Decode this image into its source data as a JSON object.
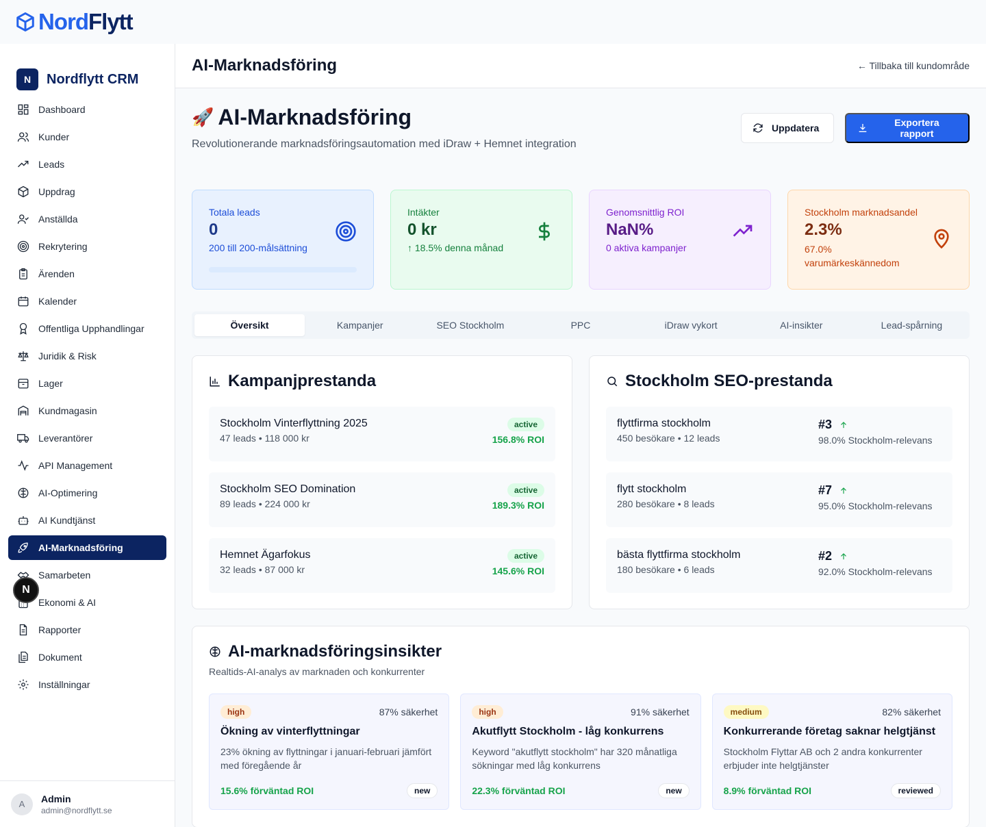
{
  "brand": {
    "part1": "Nord",
    "part2": "Flytt"
  },
  "sidebar": {
    "logo_letter": "N",
    "title": "Nordflytt CRM",
    "items": [
      {
        "label": "Dashboard"
      },
      {
        "label": "Kunder"
      },
      {
        "label": "Leads"
      },
      {
        "label": "Uppdrag"
      },
      {
        "label": "Anställda"
      },
      {
        "label": "Rekrytering"
      },
      {
        "label": "Ärenden"
      },
      {
        "label": "Kalender"
      },
      {
        "label": "Offentliga Upphandlingar"
      },
      {
        "label": "Juridik & Risk"
      },
      {
        "label": "Lager"
      },
      {
        "label": "Kundmagasin"
      },
      {
        "label": "Leverantörer"
      },
      {
        "label": "API Management"
      },
      {
        "label": "AI-Optimering"
      },
      {
        "label": "AI Kundtjänst"
      },
      {
        "label": "AI-Marknadsföring"
      },
      {
        "label": "Samarbeten"
      },
      {
        "label": "Ekonomi & AI"
      },
      {
        "label": "Rapporter"
      },
      {
        "label": "Dokument"
      },
      {
        "label": "Inställningar"
      }
    ],
    "user": {
      "initial": "A",
      "name": "Admin",
      "email": "admin@nordflytt.se"
    },
    "next_badge": "N"
  },
  "header": {
    "title": "AI-Marknadsföring",
    "back_link": "← Tillbaka till kundområde"
  },
  "hero": {
    "emoji": "🚀",
    "title": "AI-Marknadsföring",
    "subtitle": "Revolutionerande marknadsföringsautomation med iDraw + Hemnet integration",
    "refresh_label": "Uppdatera",
    "export_label": "Exportera rapport"
  },
  "stats": {
    "leads": {
      "label": "Totala leads",
      "value": "0",
      "sub": "200 till 200-målsättning",
      "progress": 0
    },
    "revenue": {
      "label": "Intäkter",
      "value": "0 kr",
      "sub": "↑ 18.5% denna månad"
    },
    "roi": {
      "label": "Genomsnittlig ROI",
      "value": "NaN%",
      "sub": "0 aktiva kampanjer"
    },
    "share": {
      "label": "Stockholm marknadsandel",
      "value": "2.3%",
      "sub": "67.0% varumärkeskännedom"
    }
  },
  "tabs": [
    "Översikt",
    "Kampanjer",
    "SEO Stockholm",
    "PPC",
    "iDraw vykort",
    "AI-insikter",
    "Lead-spårning"
  ],
  "campaigns": {
    "title": "Kampanjprestanda",
    "items": [
      {
        "name": "Stockholm Vinterflyttning 2025",
        "meta": "47 leads • 118 000 kr",
        "status": "active",
        "roi": "156.8% ROI"
      },
      {
        "name": "Stockholm SEO Domination",
        "meta": "89 leads • 224 000 kr",
        "status": "active",
        "roi": "189.3% ROI"
      },
      {
        "name": "Hemnet Ägarfokus",
        "meta": "32 leads • 87 000 kr",
        "status": "active",
        "roi": "145.6% ROI"
      }
    ]
  },
  "seo": {
    "title": "Stockholm SEO-prestanda",
    "items": [
      {
        "keyword": "flyttfirma stockholm",
        "meta": "450 besökare • 12 leads",
        "rank": "#3",
        "relevance": "98.0% Stockholm-relevans"
      },
      {
        "keyword": "flytt stockholm",
        "meta": "280 besökare • 8 leads",
        "rank": "#7",
        "relevance": "95.0% Stockholm-relevans"
      },
      {
        "keyword": "bästa flyttfirma stockholm",
        "meta": "180 besökare • 6 leads",
        "rank": "#2",
        "relevance": "92.0% Stockholm-relevans"
      }
    ]
  },
  "insights": {
    "title": "AI-marknadsföringsinsikter",
    "subtitle": "Realtids-AI-analys av marknaden och konkurrenter",
    "items": [
      {
        "priority": "high",
        "confidence": "87% säkerhet",
        "title": "Ökning av vinterflyttningar",
        "desc": "23% ökning av flyttningar i januari-februari jämfört med föregående år",
        "roi": "15.6% förväntad ROI",
        "status": "new"
      },
      {
        "priority": "high",
        "confidence": "91% säkerhet",
        "title": "Akutflytt Stockholm - låg konkurrens",
        "desc": "Keyword \"akutflytt stockholm\" har 320 månatliga sökningar med låg konkurrens",
        "roi": "22.3% förväntad ROI",
        "status": "new"
      },
      {
        "priority": "medium",
        "confidence": "82% säkerhet",
        "title": "Konkurrerande företag saknar helgtjänst",
        "desc": "Stockholm Flyttar AB och 2 andra konkurrenter erbjuder inte helgtjänster",
        "roi": "8.9% förväntad ROI",
        "status": "reviewed"
      }
    ]
  }
}
